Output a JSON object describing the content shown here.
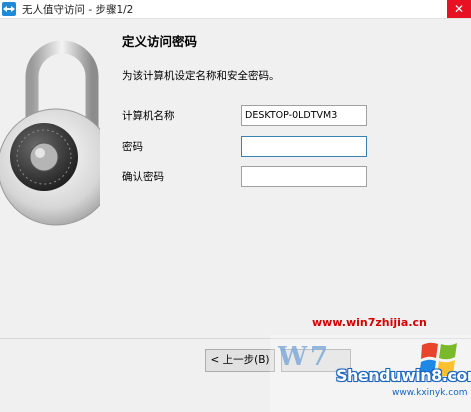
{
  "window": {
    "title": "无人值守访问 - 步骤1/2",
    "close_glyph": "✕"
  },
  "page": {
    "heading": "定义访问密码",
    "description": "为该计算机设定名称和安全密码。"
  },
  "form": {
    "computer_name_label": "计算机名称",
    "computer_name_value": "DESKTOP-0LDTVM3",
    "password_label": "密码",
    "password_value": "",
    "confirm_password_label": "确认密码",
    "confirm_password_value": ""
  },
  "buttons": {
    "back_label": "< 上一步(B)"
  },
  "watermarks": {
    "top": "www.win7zhijia.cn",
    "main": "Shenduwin8.com",
    "sub": "www.kxinyk.com"
  },
  "colors": {
    "close_red": "#e81123",
    "watermark_red": "#d40000",
    "win_blue": "#1e6fd9"
  }
}
